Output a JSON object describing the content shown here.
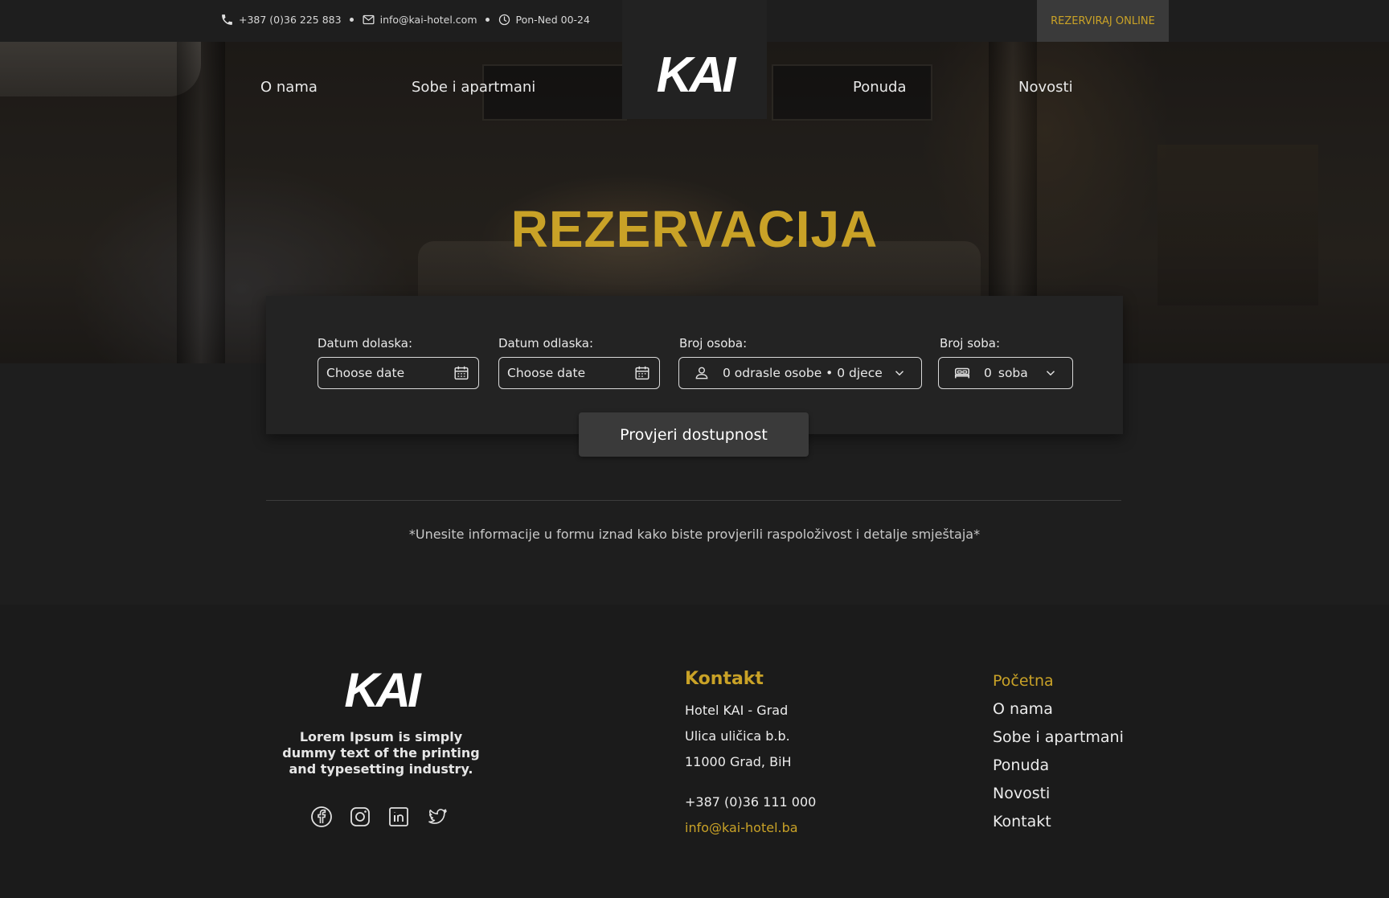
{
  "topbar": {
    "phone": "+387 (0)36 225 883",
    "email": "info@kai-hotel.com",
    "hours": "Pon-Ned 00-24",
    "cta": "REZERVIRAJ ONLINE"
  },
  "brand": {
    "logo": "KAI"
  },
  "nav": {
    "items": [
      "O nama",
      "Sobe i apartmani",
      "Ponuda",
      "Novosti"
    ]
  },
  "hero": {
    "title": "REZERVACIJA"
  },
  "booking": {
    "arrival_label": "Datum dolaska:",
    "arrival_placeholder": "Choose date",
    "departure_label": "Datum odlaska:",
    "departure_placeholder": "Choose date",
    "guests_label": "Broj osoba:",
    "guests_value": "0 odrasle osobe • 0 djece",
    "rooms_label": "Broj soba:",
    "rooms_count": "0",
    "rooms_unit": "soba",
    "submit": "Provjeri dostupnost"
  },
  "note": "*Unesite informacije u formu iznad kako biste provjerili raspoloživost i detalje smještaja*",
  "footer": {
    "logo": "KAI",
    "description": "Lorem Ipsum is simply dummy text of the printing and typesetting industry.",
    "socials": [
      "facebook-icon",
      "instagram-icon",
      "linkedin-icon",
      "twitter-icon"
    ],
    "contact_heading": "Kontakt",
    "address_1": "Hotel KAI - Grad",
    "address_2": "Ulica uličica b.b.",
    "address_3": "11000 Grad, BiH",
    "phone": "+387 (0)36 111 000",
    "email": "info@kai-hotel.ba",
    "links": [
      "Početna",
      "O nama",
      "Sobe i apartmani",
      "Ponuda",
      "Novosti",
      "Kontakt"
    ]
  },
  "colors": {
    "accent": "#c9a227",
    "background": "#1e1e1e",
    "panel": "#232323"
  }
}
